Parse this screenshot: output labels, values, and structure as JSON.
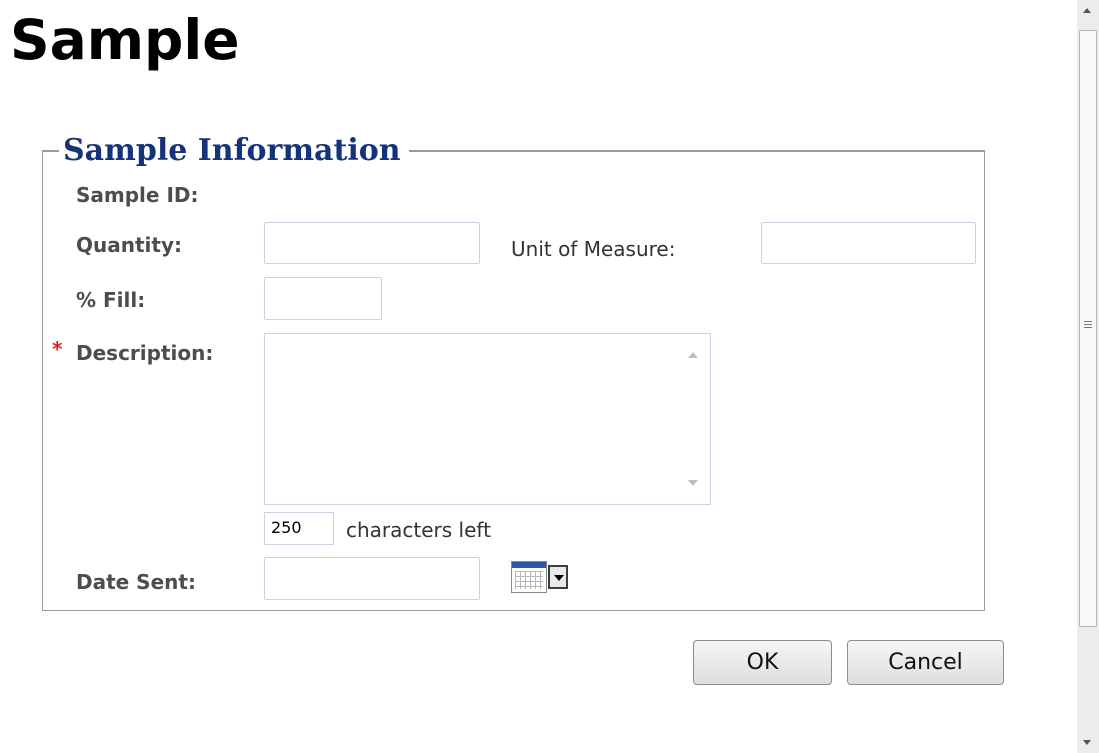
{
  "page": {
    "title": "Sample"
  },
  "form": {
    "legend": "Sample Information",
    "sample_id": {
      "label": "Sample ID:",
      "value": ""
    },
    "quantity": {
      "label": "Quantity:",
      "value": ""
    },
    "unit_of_measure": {
      "label": "Unit of Measure:",
      "value": ""
    },
    "fill": {
      "label": "% Fill:",
      "value": ""
    },
    "description": {
      "required_marker": "*",
      "label": "Description:",
      "value": ""
    },
    "characters_left": {
      "count": "250",
      "text": "characters left"
    },
    "date_sent": {
      "label": "Date Sent:",
      "value": ""
    },
    "calendar_icon": "calendar-icon"
  },
  "actions": {
    "ok_label": "OK",
    "cancel_label": "Cancel"
  },
  "colors": {
    "legend": "#15337a",
    "required": "#e21b1b",
    "input_border": "#c8d3e6"
  }
}
